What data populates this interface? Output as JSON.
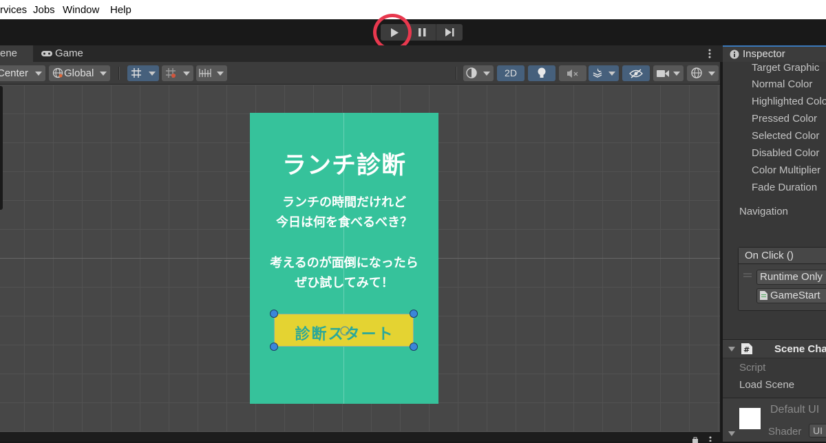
{
  "menu": [
    "rvices",
    "Jobs",
    "Window",
    "Help"
  ],
  "playbar": {
    "play_icon": "play-icon",
    "pause_icon": "pause-icon",
    "step_icon": "step-icon"
  },
  "tabs": {
    "scene": "ene",
    "game": "Game",
    "game_icon": "gamepad-icon"
  },
  "scene_toolbar": {
    "pivot": "Center",
    "space": "Global",
    "mode_2d": "2D"
  },
  "canvas": {
    "title": "ランチ診断",
    "body_line1": "ランチの時間だけれど",
    "body_line2": "今日は何を食べるべき？",
    "body_line3": "考えるのが面倒になったら",
    "body_line4": "ぜひ試してみて！",
    "button_label": "診断スタート",
    "bg_color": "#36c29b",
    "button_color": "#e4d332"
  },
  "inspector": {
    "tab": "Inspector",
    "props": [
      "Target Graphic",
      "Normal Color",
      "Highlighted Color",
      "Pressed Color",
      "Selected Color",
      "Disabled Color",
      "Color Multiplier",
      "Fade Duration"
    ],
    "navigation": "Navigation",
    "onclick": "On Click ()",
    "runtime": "Runtime Only",
    "object": "GameStart",
    "component": "Scene Cha",
    "script_label": "Script",
    "load_scene": "Load Scene",
    "material": "Default UI",
    "shader_label": "Shader",
    "shader_value": "UI"
  },
  "accent": "#e8384e"
}
